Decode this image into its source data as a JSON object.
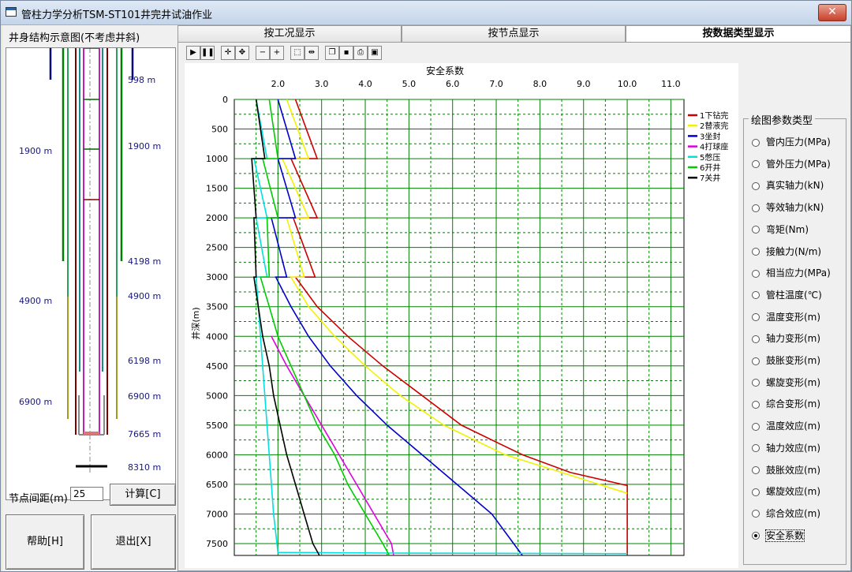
{
  "window": {
    "title": "管柱力学分析TSM-ST101井完井试油作业",
    "close_label": "✕"
  },
  "left": {
    "title": "井身结构示意图(不考虑井斜)",
    "depth_labels_right": [
      "598 m",
      "1900 m",
      "4198 m",
      "4900 m",
      "6198 m",
      "6900 m",
      "7665 m",
      "8310 m"
    ],
    "depth_labels_left": [
      "1900 m",
      "4900 m",
      "6900 m"
    ],
    "node_label": "节点间距(m)",
    "node_value": "25",
    "calc_label": "计算[C]",
    "help_label": "帮助[H]",
    "exit_label": "退出[X]"
  },
  "tabs": [
    {
      "label": "按工况显示",
      "active": false
    },
    {
      "label": "按节点显示",
      "active": false
    },
    {
      "label": "按数据类型显示",
      "active": true
    }
  ],
  "toolbar": {
    "icons": [
      "play-icon",
      "pause-icon",
      "crosshair-icon",
      "pan-icon",
      "zoom-out-icon",
      "zoom-in-icon",
      "select-icon",
      "fit-icon",
      "copy-icon",
      "save-icon",
      "print-icon",
      "print-preview-icon"
    ]
  },
  "param_group": {
    "title": "绘图参数类型",
    "options": [
      "管内压力(MPa)",
      "管外压力(MPa)",
      "真实轴力(kN)",
      "等效轴力(kN)",
      "弯矩(Nm)",
      "接触力(N/m)",
      "相当应力(MPa)",
      "管柱温度(℃)",
      "温度变形(m)",
      "轴力变形(m)",
      "鼓胀变形(m)",
      "螺旋变形(m)",
      "综合变形(m)",
      "温度效应(m)",
      "轴力效应(m)",
      "鼓胀效应(m)",
      "螺旋效应(m)",
      "综合效应(m)",
      "安全系数"
    ],
    "selected": 18
  },
  "chart_data": {
    "type": "line",
    "title": "安全系数",
    "xlabel": "安全系数",
    "ylabel": "井深(m)",
    "xlim": [
      1.0,
      11.3
    ],
    "ylim": [
      0,
      7700
    ],
    "y_inverted": true,
    "x_ticks": [
      2.0,
      3.0,
      4.0,
      5.0,
      6.0,
      7.0,
      8.0,
      9.0,
      10.0,
      11.0
    ],
    "y_ticks": [
      0,
      500,
      1000,
      1500,
      2000,
      2500,
      3000,
      3500,
      4000,
      4500,
      5000,
      5500,
      6000,
      6500,
      7000,
      7500
    ],
    "x_tick_labels": [
      "2.0",
      "3.0",
      "4.0",
      "5.0",
      "6.0",
      "7.0",
      "8.0",
      "9.0",
      "10.0",
      "11.0"
    ],
    "grid": true,
    "legend_position": "top-right",
    "series": [
      {
        "name": "1下钻完",
        "color": "#cc0000",
        "points": [
          [
            2.4,
            0
          ],
          [
            2.9,
            1000
          ],
          [
            2.3,
            1000
          ],
          [
            2.9,
            2000
          ],
          [
            2.35,
            2000
          ],
          [
            2.85,
            3000
          ],
          [
            2.4,
            3000
          ],
          [
            2.9,
            3500
          ],
          [
            3.6,
            4000
          ],
          [
            4.4,
            4500
          ],
          [
            5.3,
            5000
          ],
          [
            6.2,
            5500
          ],
          [
            7.6,
            6000
          ],
          [
            8.7,
            6300
          ],
          [
            10.0,
            6520
          ],
          [
            10.0,
            7700
          ]
        ]
      },
      {
        "name": "2替液完",
        "color": "#f2f200",
        "points": [
          [
            2.2,
            0
          ],
          [
            2.7,
            1000
          ],
          [
            2.1,
            1000
          ],
          [
            2.7,
            2000
          ],
          [
            2.2,
            2000
          ],
          [
            2.6,
            3000
          ],
          [
            2.3,
            3000
          ],
          [
            2.7,
            3500
          ],
          [
            3.3,
            4000
          ],
          [
            4.0,
            4500
          ],
          [
            4.8,
            5000
          ],
          [
            5.8,
            5500
          ],
          [
            7.2,
            6000
          ],
          [
            8.5,
            6300
          ],
          [
            10.0,
            6650
          ]
        ]
      },
      {
        "name": "3坐封",
        "color": "#0000cc",
        "points": [
          [
            2.0,
            0
          ],
          [
            2.4,
            1000
          ],
          [
            2.0,
            1000
          ],
          [
            2.4,
            2000
          ],
          [
            1.85,
            2000
          ],
          [
            2.2,
            3000
          ],
          [
            1.95,
            3000
          ],
          [
            2.3,
            3500
          ],
          [
            2.7,
            4000
          ],
          [
            3.2,
            4500
          ],
          [
            3.8,
            5000
          ],
          [
            4.5,
            5500
          ],
          [
            5.3,
            6000
          ],
          [
            6.1,
            6500
          ],
          [
            6.9,
            7000
          ],
          [
            7.6,
            7700
          ]
        ]
      },
      {
        "name": "4打球座",
        "color": "#dd00dd",
        "points": [
          [
            1.85,
            4000
          ],
          [
            2.2,
            4500
          ],
          [
            2.6,
            5000
          ],
          [
            3.0,
            5500
          ],
          [
            3.4,
            6000
          ],
          [
            3.8,
            6500
          ],
          [
            4.2,
            7000
          ],
          [
            4.6,
            7500
          ],
          [
            4.65,
            7700
          ]
        ]
      },
      {
        "name": "5憋压",
        "color": "#00e0e0",
        "points": [
          [
            1.5,
            0
          ],
          [
            1.75,
            1000
          ],
          [
            1.45,
            1000
          ],
          [
            1.75,
            2000
          ],
          [
            1.5,
            2000
          ],
          [
            1.75,
            3000
          ],
          [
            1.5,
            3000
          ],
          [
            1.6,
            4000
          ],
          [
            1.7,
            5000
          ],
          [
            1.8,
            6000
          ],
          [
            1.9,
            7000
          ],
          [
            2.0,
            7650
          ],
          [
            4.6,
            7660
          ],
          [
            10.0,
            7670
          ]
        ]
      },
      {
        "name": "6开井",
        "color": "#00cc00",
        "points": [
          [
            1.8,
            0
          ],
          [
            2.0,
            1000
          ],
          [
            1.65,
            1000
          ],
          [
            2.0,
            2000
          ],
          [
            1.75,
            2000
          ],
          [
            1.8,
            3000
          ],
          [
            1.6,
            3000
          ],
          [
            1.8,
            3500
          ],
          [
            2.0,
            4000
          ],
          [
            2.3,
            4500
          ],
          [
            2.6,
            5000
          ],
          [
            2.9,
            5500
          ],
          [
            3.3,
            6000
          ],
          [
            3.6,
            6500
          ],
          [
            4.0,
            7000
          ],
          [
            4.4,
            7500
          ],
          [
            4.55,
            7700
          ]
        ]
      },
      {
        "name": "7关井",
        "color": "#000000",
        "points": [
          [
            1.5,
            0
          ],
          [
            1.7,
            1000
          ],
          [
            1.4,
            1000
          ],
          [
            1.5,
            2000
          ],
          [
            1.45,
            2000
          ],
          [
            1.5,
            3000
          ],
          [
            1.45,
            3000
          ],
          [
            1.55,
            3500
          ],
          [
            1.65,
            4000
          ],
          [
            1.8,
            4500
          ],
          [
            1.9,
            5000
          ],
          [
            2.05,
            5500
          ],
          [
            2.2,
            6000
          ],
          [
            2.4,
            6500
          ],
          [
            2.6,
            7000
          ],
          [
            2.8,
            7500
          ],
          [
            2.95,
            7700
          ]
        ]
      }
    ]
  }
}
